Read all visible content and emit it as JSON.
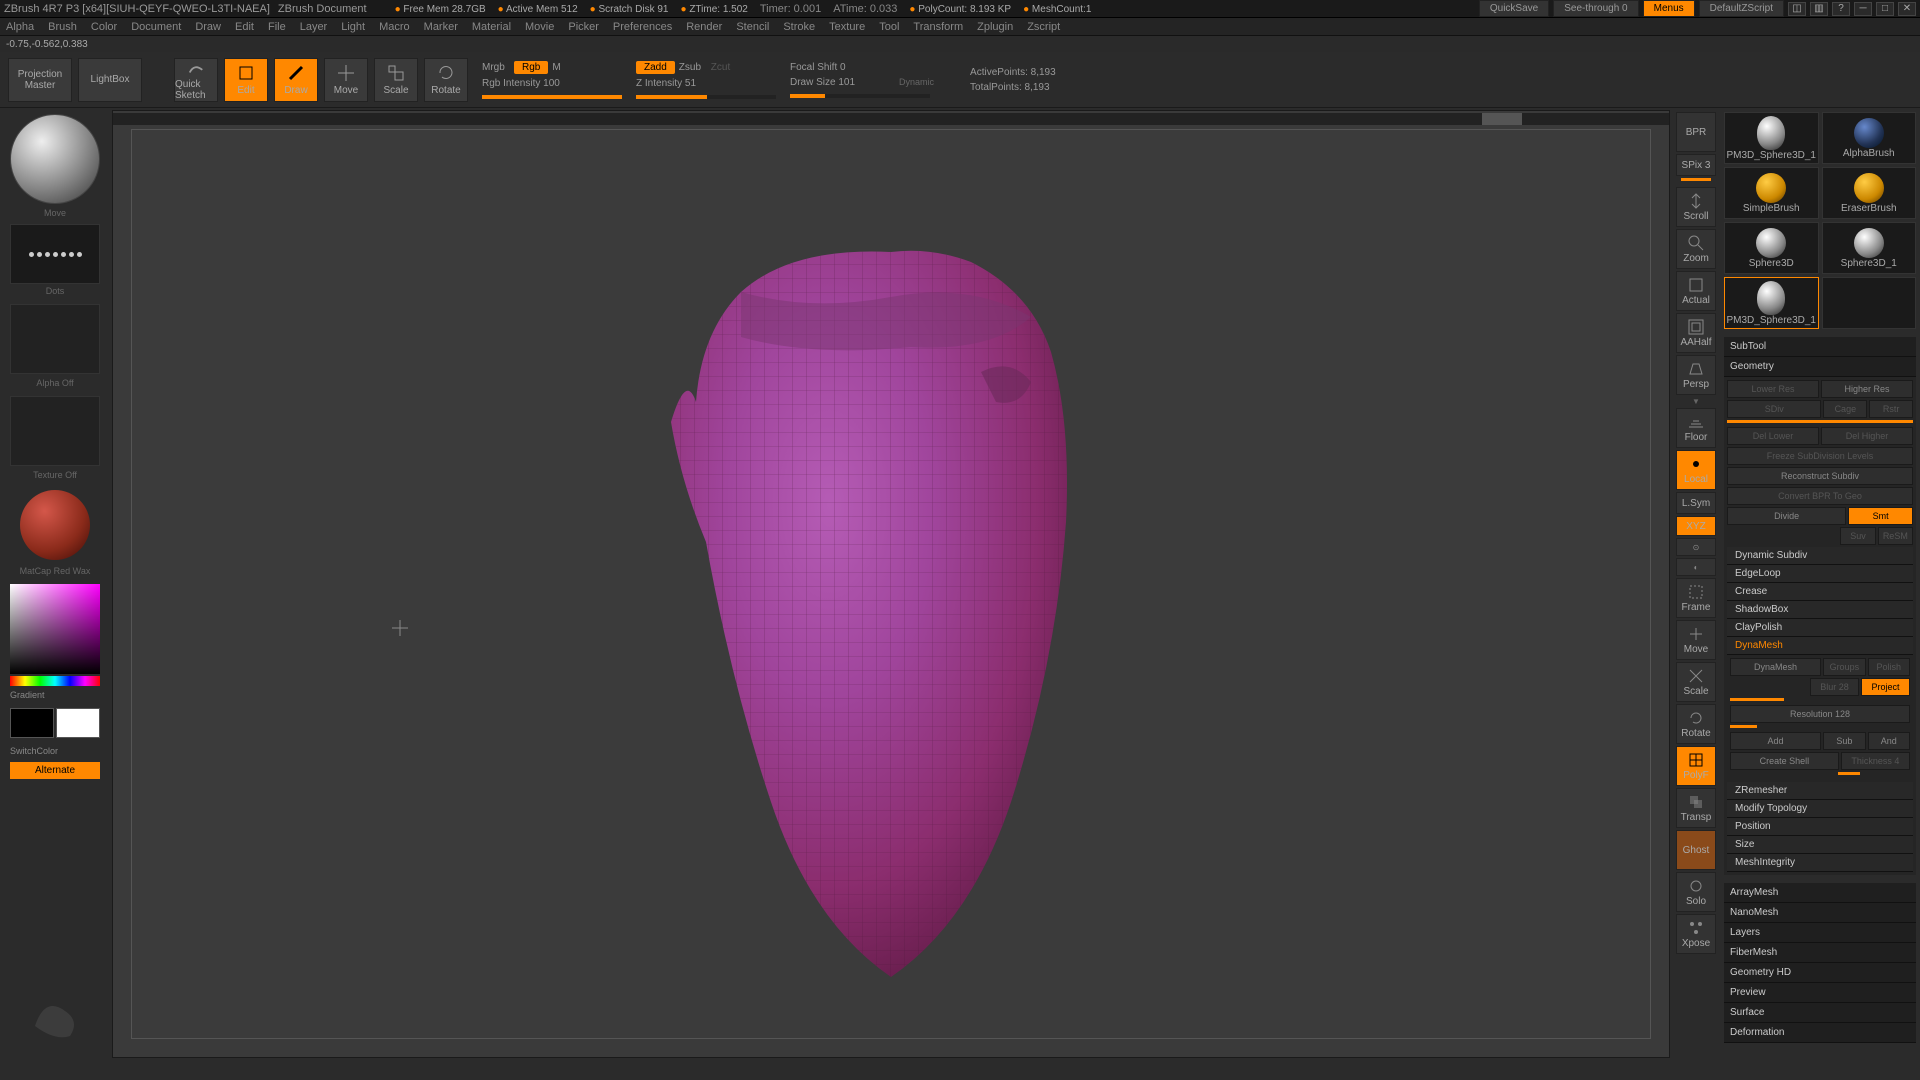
{
  "title": "ZBrush 4R7 P3 [x64][SIUH-QEYF-QWEO-L3TI-NAEA]",
  "doc": "ZBrush Document",
  "stats": {
    "freemem": "Free Mem 28.7GB",
    "activemem": "Active Mem 512",
    "scratch": "Scratch Disk 91",
    "ztime": "ZTime: 1.502",
    "timer": "Timer: 0.001",
    "atime": "ATime: 0.033",
    "poly": "PolyCount: 8.193 KP",
    "meshcount": "MeshCount:1"
  },
  "topbtns": {
    "quicksave": "QuickSave",
    "seethrough": "See-through   0",
    "menus": "Menus",
    "script": "DefaultZScript"
  },
  "menu": [
    "Alpha",
    "Brush",
    "Color",
    "Document",
    "Draw",
    "Edit",
    "File",
    "Layer",
    "Light",
    "Macro",
    "Marker",
    "Material",
    "Movie",
    "Picker",
    "Preferences",
    "Render",
    "Stencil",
    "Stroke",
    "Texture",
    "Tool",
    "Transform",
    "Zplugin",
    "Zscript"
  ],
  "coords": "-0.75,-0.562,0.383",
  "toolbar": {
    "projection": "Projection Master",
    "lightbox": "LightBox",
    "quicksketch": "Quick Sketch",
    "edit": "Edit",
    "draw": "Draw",
    "move": "Move",
    "scale": "Scale",
    "rotate": "Rotate",
    "mrgb": "Mrgb",
    "rgb": "Rgb",
    "m": "M",
    "rgbint": "Rgb Intensity 100",
    "zadd": "Zadd",
    "zsub": "Zsub",
    "zcut": "Zcut",
    "zint": "Z Intensity 51",
    "focal": "Focal Shift 0",
    "drawsize": "Draw Size 101",
    "dynamic": "Dynamic",
    "active": "ActivePoints: 8,193",
    "total": "TotalPoints: 8,193"
  },
  "left": {
    "brush": "Move",
    "stroke": "Dots",
    "alpha": "Alpha Off",
    "texture": "Texture Off",
    "material": "MatCap Red Wax",
    "gradient": "Gradient",
    "switch": "SwitchColor",
    "alternate": "Alternate"
  },
  "right": [
    "BPR",
    "SPix 3",
    "Scroll",
    "Zoom",
    "Actual",
    "AAHalf",
    "Persp",
    "Floor",
    "Local",
    "L.Sym",
    "XYZ",
    "",
    "",
    "Frame",
    "Move",
    "Scale",
    "Rotate",
    "PolyF",
    "Transp",
    "Ghost",
    "Solo",
    "Xpose"
  ],
  "tools": {
    "items": [
      "PM3D_Sphere3D_1",
      "AlphaBrush",
      "SimpleBrush",
      "EraserBrush",
      "Sphere3D",
      "Sphere3D_1",
      "PM3D_Sphere3D_1"
    ],
    "subtool": "SubTool",
    "geometry": "Geometry",
    "lowres": "Lower Res",
    "highres": "Higher Res",
    "sdiv": "SDiv",
    "cage": "Cage",
    "rstr": "Rstr",
    "dellower": "Del Lower",
    "delhigher": "Del Higher",
    "freeze": "Freeze SubDivision Levels",
    "reconstruct": "Reconstruct Subdiv",
    "convert": "Convert BPR To Geo",
    "divide": "Divide",
    "smt": "Smt",
    "suv": "Suv",
    "resm": "ReSM",
    "dynsub": "Dynamic Subdiv",
    "edgeloop": "EdgeLoop",
    "crease": "Crease",
    "shadowbox": "ShadowBox",
    "claypolish": "ClayPolish",
    "dynamesh": "DynaMesh",
    "dynameshbtn": "DynaMesh",
    "groups": "Groups",
    "polish": "Polish",
    "blur": "Blur 28",
    "project": "Project",
    "resolution": "Resolution 128",
    "add": "Add",
    "sub": "Sub",
    "and": "And",
    "createshell": "Create Shell",
    "thickness": "Thickness 4",
    "zremesher": "ZRemesher",
    "modtopo": "Modify Topology",
    "position": "Position",
    "size": "Size",
    "meshint": "MeshIntegrity",
    "arraymesh": "ArrayMesh",
    "nanomesh": "NanoMesh",
    "layers": "Layers",
    "fibermesh": "FiberMesh",
    "geohd": "Geometry HD",
    "preview": "Preview",
    "surface": "Surface",
    "deformation": "Deformation"
  }
}
